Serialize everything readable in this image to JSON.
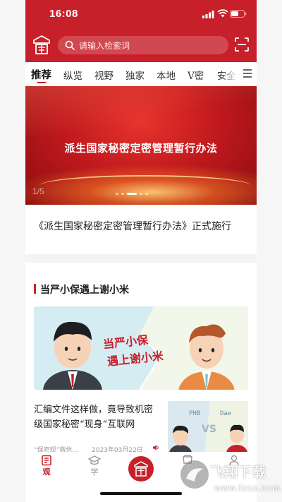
{
  "status_bar": {
    "time": "16:08",
    "icons": [
      "signal-icon",
      "wifi-icon",
      "battery-icon"
    ]
  },
  "header": {
    "logo_icon": "seal-logo-icon",
    "search_placeholder": "请输入检索词",
    "scan_icon": "scan-icon"
  },
  "tabs": [
    {
      "label": "推荐",
      "active": true
    },
    {
      "label": "纵览",
      "active": false
    },
    {
      "label": "视野",
      "active": false
    },
    {
      "label": "独家",
      "active": false
    },
    {
      "label": "本地",
      "active": false
    },
    {
      "label": "V密",
      "active": false
    },
    {
      "label": "安全",
      "active": false
    }
  ],
  "banner": {
    "title": "派生国家秘密定密管理暂行办法",
    "index": "1/5",
    "slide_count": 5,
    "active_slide": 3
  },
  "headline": "《派生国家秘密定密管理暂行办法》正式施行",
  "section": {
    "title": "当严小保遇上谢小米",
    "feature_image_text": "当严小保遇上谢小米"
  },
  "article": {
    "title": "汇编文件这样做，竟导致机密级国家秘密“现身”互联网",
    "source": "“保密观”微信...",
    "date": "2023年03月22日",
    "thumb_text_left": "PHB",
    "thumb_text_vs": "VS",
    "thumb_text_right": "Dae"
  },
  "tab_bar": [
    {
      "label": "观",
      "icon": "news-icon",
      "active": true
    },
    {
      "label": "学",
      "icon": "graduation-cap-icon",
      "active": false
    },
    {
      "label": "",
      "icon": "seal-logo-icon",
      "active": false
    },
    {
      "label": "",
      "icon": "books-icon",
      "active": false
    },
    {
      "label": "",
      "icon": "profile-icon",
      "active": false
    }
  ],
  "watermark": {
    "text": "飞翔下载",
    "url": "www.fxxz.com"
  },
  "colors": {
    "brand_red": "#c8202a",
    "text_dark": "#222222",
    "text_muted": "#999999"
  }
}
